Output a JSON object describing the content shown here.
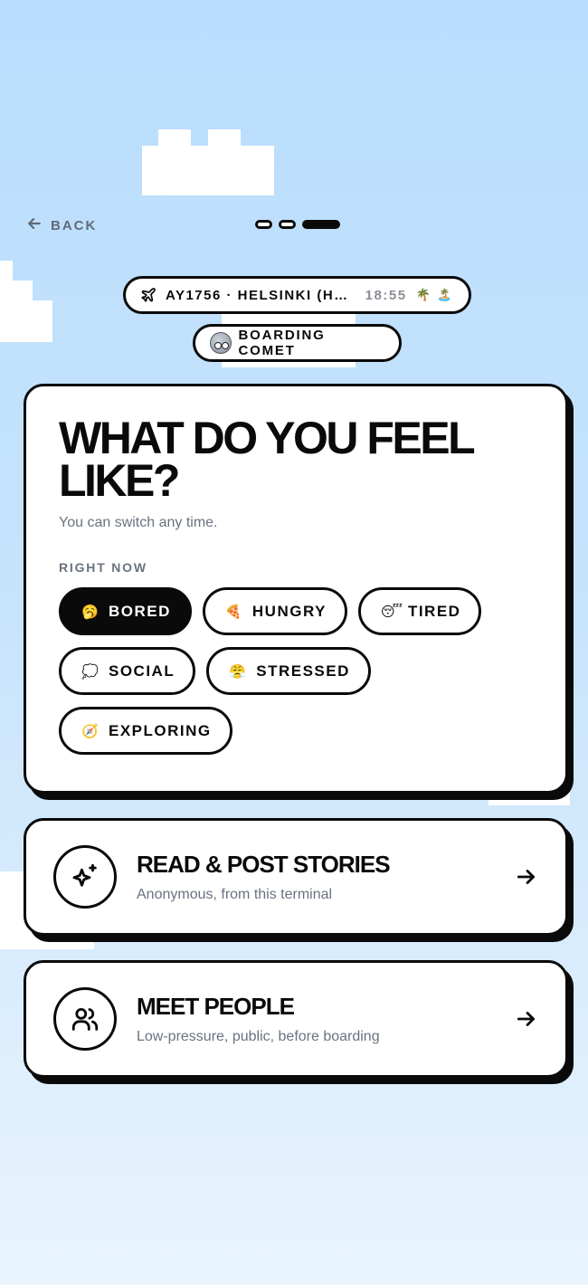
{
  "nav": {
    "back_label": "BACK",
    "progress": {
      "total": 3,
      "current": 3
    }
  },
  "flight": {
    "text": "AY1756 · HELSINKI (H…",
    "time": "18:55",
    "emojis": "🌴 🏝️"
  },
  "comet": {
    "label": "BOARDING COMET"
  },
  "main": {
    "title": "WHAT DO YOU FEEL LIKE?",
    "subtitle": "You can switch any time.",
    "section_label": "RIGHT NOW",
    "moods": [
      {
        "label": "BORED",
        "emoji": "🥱",
        "selected": true
      },
      {
        "label": "HUNGRY",
        "emoji": "🍕",
        "selected": false
      },
      {
        "label": "TIRED",
        "emoji": "😴",
        "selected": false
      },
      {
        "label": "SOCIAL",
        "emoji": "💭",
        "selected": false
      },
      {
        "label": "STRESSED",
        "emoji": "😤",
        "selected": false
      },
      {
        "label": "EXPLORING",
        "emoji": "🧭",
        "selected": false
      }
    ]
  },
  "actions": [
    {
      "title": "READ & POST STORIES",
      "subtitle": "Anonymous, from this terminal",
      "icon": "sparkles-icon"
    },
    {
      "title": "MEET PEOPLE",
      "subtitle": "Low-pressure, public, before boarding",
      "icon": "people-icon"
    }
  ],
  "colors": {
    "ink": "#0a0a0a",
    "muted": "#6a7280",
    "sky_top": "#b9ddfd",
    "sky_bottom": "#e9f4fd",
    "card": "#ffffff"
  }
}
